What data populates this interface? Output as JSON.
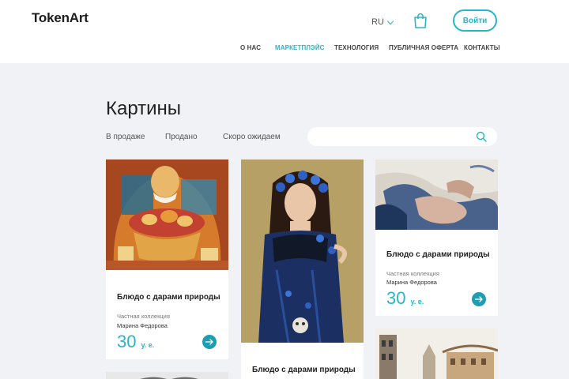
{
  "header": {
    "logo": "TokenArt",
    "lang": "RU",
    "login_label": "Войти"
  },
  "nav": [
    {
      "label": "О НАС",
      "active": false
    },
    {
      "label": "МАРКЕТПЛЭЙС",
      "active": true
    },
    {
      "label": "ТЕХНОЛОГИЯ",
      "active": false
    },
    {
      "label": "ПУБЛИЧНАЯ ОФЕРТА",
      "active": false
    },
    {
      "label": "КОНТАКТЫ",
      "active": false
    }
  ],
  "page": {
    "title": "Картины"
  },
  "tabs": [
    "В продаже",
    "Продано",
    "Скоро ожидаем"
  ],
  "search": {
    "placeholder": "",
    "value": ""
  },
  "cards": [
    {
      "title": "Блюдо с дарами природы",
      "collection": "Частная коллекция",
      "author": "Марина Федорова",
      "price": "30",
      "currency": "у. е."
    },
    {
      "title": "Блюдо с дарами природы",
      "collection": "",
      "author": "",
      "price": "",
      "currency": ""
    },
    {
      "title": "Блюдо с дарами природы",
      "collection": "Частная коллекция",
      "author": "Марина Федорова",
      "price": "30",
      "currency": "у. е."
    }
  ],
  "colors": {
    "accent": "#27b5c9",
    "accent_dark": "#1e9fb1",
    "background": "#f1f2f6"
  },
  "icons": [
    "cart-icon",
    "search-icon",
    "arrow-right-icon",
    "chevron-down-icon"
  ]
}
